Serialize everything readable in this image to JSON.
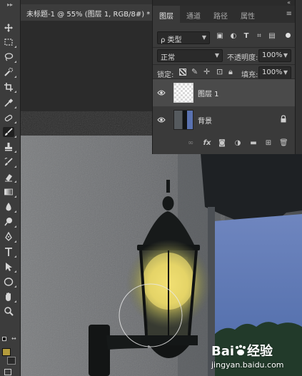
{
  "document": {
    "tab_title": "未标题-1 @ 55% (图层 1, RGB/8#)",
    "modified_mark": "*",
    "close_glyph": "×"
  },
  "tools": [
    {
      "name": "move-tool-icon"
    },
    {
      "name": "marquee-tool-icon"
    },
    {
      "name": "lasso-tool-icon"
    },
    {
      "name": "quick-select-tool-icon"
    },
    {
      "name": "crop-tool-icon"
    },
    {
      "name": "eyedropper-tool-icon"
    },
    {
      "name": "healing-brush-tool-icon"
    },
    {
      "name": "brush-tool-icon",
      "active": true
    },
    {
      "name": "clone-stamp-tool-icon"
    },
    {
      "name": "history-brush-tool-icon"
    },
    {
      "name": "eraser-tool-icon"
    },
    {
      "name": "gradient-tool-icon"
    },
    {
      "name": "blur-tool-icon"
    },
    {
      "name": "dodge-tool-icon"
    },
    {
      "name": "pen-tool-icon"
    },
    {
      "name": "type-tool-icon"
    },
    {
      "name": "path-select-tool-icon"
    },
    {
      "name": "ellipse-tool-icon"
    },
    {
      "name": "hand-tool-icon"
    },
    {
      "name": "zoom-tool-icon"
    }
  ],
  "colors": {
    "foreground": "#b39b3c",
    "background": "#2a2a2a",
    "brush_glow": "#f3e27a",
    "panel_bg": "#3a3a3a",
    "selected_layer": "#4a4a4a"
  },
  "layers_panel": {
    "tabs": [
      {
        "label": "图层",
        "active": true
      },
      {
        "label": "通道",
        "active": false
      },
      {
        "label": "路径",
        "active": false
      },
      {
        "label": "属性",
        "active": false
      }
    ],
    "collapse_glyph": "«",
    "menu_glyph": "≡",
    "filter": {
      "search_glyph": "ρ",
      "label": "类型"
    },
    "filter_icons": [
      "image-filter-icon",
      "adjustment-filter-icon",
      "type-filter-icon",
      "shape-filter-icon",
      "smart-object-filter-icon",
      "filter-toggle-icon"
    ],
    "blend_mode": "正常",
    "opacity_label": "不透明度:",
    "opacity_value": "100%",
    "lock_label": "锁定:",
    "fill_label": "填充:",
    "fill_value": "100%",
    "layers": [
      {
        "name": "图层 1",
        "visible": true,
        "selected": true,
        "locked": false
      },
      {
        "name": "背景",
        "visible": true,
        "selected": false,
        "locked": true
      }
    ],
    "bottom_icons": [
      "link-layers-icon",
      "fx-icon",
      "add-mask-icon",
      "adjustment-layer-icon",
      "new-group-icon",
      "new-layer-icon",
      "delete-layer-icon"
    ]
  },
  "watermark": {
    "brand": "Bai",
    "brand_suffix": "经验",
    "url": "jingyan.baidu.com"
  }
}
